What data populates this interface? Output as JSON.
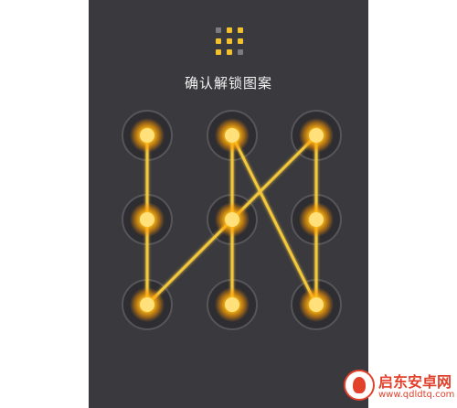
{
  "screen": {
    "title": "确认解锁图案",
    "background_color": "#3a3a3e"
  },
  "pattern_preview": {
    "icon": "grid-icon",
    "active_dots": [
      2,
      3,
      4,
      5,
      6,
      7,
      8
    ]
  },
  "pattern": {
    "nodes": [
      {
        "label": "1",
        "active": true
      },
      {
        "label": "2",
        "active": true
      },
      {
        "label": "3",
        "active": true
      },
      {
        "label": "4",
        "active": true
      },
      {
        "label": "5",
        "active": true
      },
      {
        "label": "6",
        "active": true
      },
      {
        "label": "7",
        "active": true
      },
      {
        "label": "8",
        "active": true
      },
      {
        "label": "9",
        "active": true
      }
    ],
    "path": [
      1,
      4,
      7,
      5,
      3,
      6,
      9,
      2,
      8
    ],
    "line_color": "#f5c83a",
    "glow_color": "#ffb000"
  },
  "watermark": {
    "name": "启东安卓网",
    "url": "www.qdldtq.com",
    "color": "#e2412c"
  }
}
